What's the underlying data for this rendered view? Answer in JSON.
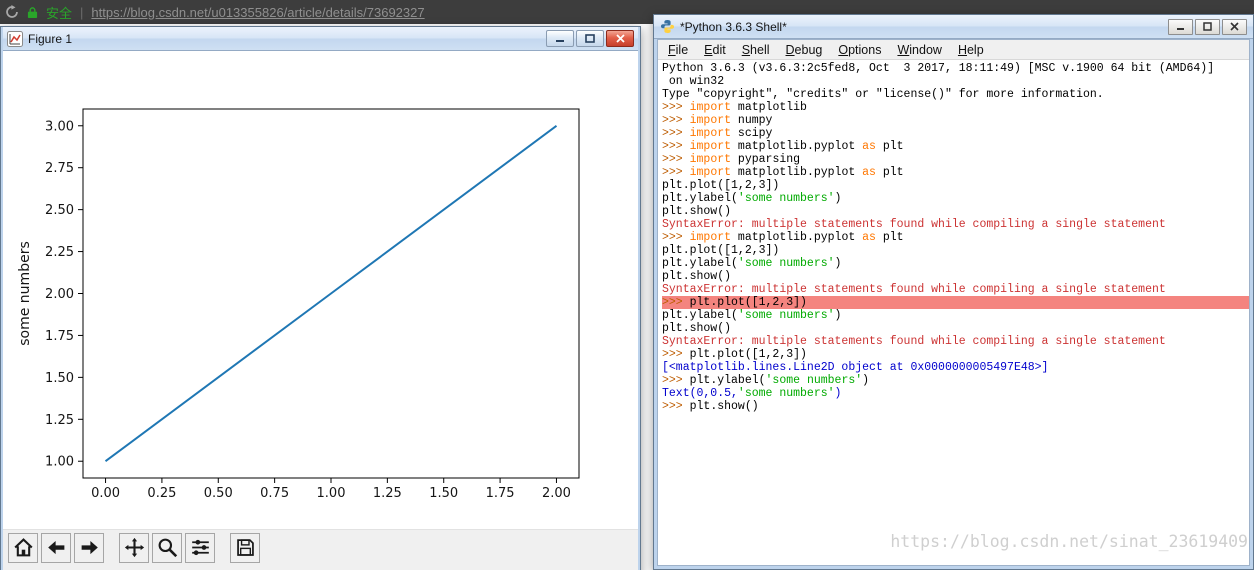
{
  "browser": {
    "security_text": "安全",
    "separator": "|",
    "url": "https://blog.csdn.net/u013355826/article/details/73692327"
  },
  "figure_window": {
    "title": "Figure 1",
    "toolbar": [
      "home",
      "back",
      "forward",
      "pan",
      "zoom",
      "configure",
      "save"
    ]
  },
  "chart_data": {
    "type": "line",
    "x": [
      0,
      1,
      2
    ],
    "y": [
      1,
      2,
      3
    ],
    "title": "",
    "xlabel": "",
    "ylabel": "some numbers",
    "xlim": [
      -0.1,
      2.1
    ],
    "ylim": [
      0.9,
      3.1
    ],
    "xticks": [
      0,
      0.25,
      0.5,
      0.75,
      1,
      1.25,
      1.5,
      1.75,
      2
    ],
    "yticks": [
      1,
      1.25,
      1.5,
      1.75,
      2,
      2.25,
      2.5,
      2.75,
      3
    ],
    "line_color": "#1f77b4",
    "grid": false,
    "legend": false
  },
  "shell_window": {
    "title": "*Python 3.6.3 Shell*",
    "menu": [
      "File",
      "Edit",
      "Shell",
      "Debug",
      "Options",
      "Window",
      "Help"
    ],
    "colors": {
      "plain": "#000000",
      "prompt": "#bd5c00",
      "keyword": "#ff7700",
      "string": "#00aa00",
      "error": "#cc3333",
      "output": "#0000cd",
      "highlight_bg": "#f4847f"
    },
    "lines": [
      {
        "segments": [
          {
            "c": "plain",
            "t": "Python 3.6.3 (v3.6.3:2c5fed8, Oct  3 2017, 18:11:49) [MSC v.1900 64 bit (AMD64)]"
          }
        ]
      },
      {
        "segments": [
          {
            "c": "plain",
            "t": " on win32"
          }
        ]
      },
      {
        "segments": [
          {
            "c": "plain",
            "t": "Type \"copyright\", \"credits\" or \"license()\" for more information."
          }
        ]
      },
      {
        "segments": [
          {
            "c": "prompt",
            "t": ">>> "
          },
          {
            "c": "keyword",
            "t": "import"
          },
          {
            "c": "plain",
            "t": " matplotlib"
          }
        ]
      },
      {
        "segments": [
          {
            "c": "prompt",
            "t": ">>> "
          },
          {
            "c": "keyword",
            "t": "import"
          },
          {
            "c": "plain",
            "t": " numpy"
          }
        ]
      },
      {
        "segments": [
          {
            "c": "prompt",
            "t": ">>> "
          },
          {
            "c": "keyword",
            "t": "import"
          },
          {
            "c": "plain",
            "t": " scipy"
          }
        ]
      },
      {
        "segments": [
          {
            "c": "prompt",
            "t": ">>> "
          },
          {
            "c": "keyword",
            "t": "import"
          },
          {
            "c": "plain",
            "t": " matplotlib.pyplot "
          },
          {
            "c": "keyword",
            "t": "as"
          },
          {
            "c": "plain",
            "t": " plt"
          }
        ]
      },
      {
        "segments": [
          {
            "c": "prompt",
            "t": ">>> "
          },
          {
            "c": "keyword",
            "t": "import"
          },
          {
            "c": "plain",
            "t": " pyparsing"
          }
        ]
      },
      {
        "segments": [
          {
            "c": "prompt",
            "t": ">>> "
          },
          {
            "c": "keyword",
            "t": "import"
          },
          {
            "c": "plain",
            "t": " matplotlib.pyplot "
          },
          {
            "c": "keyword",
            "t": "as"
          },
          {
            "c": "plain",
            "t": " plt"
          }
        ]
      },
      {
        "segments": [
          {
            "c": "plain",
            "t": "plt.plot([1,2,3])"
          }
        ]
      },
      {
        "segments": [
          {
            "c": "plain",
            "t": "plt.ylabel("
          },
          {
            "c": "string",
            "t": "'some numbers'"
          },
          {
            "c": "plain",
            "t": ")"
          }
        ]
      },
      {
        "segments": [
          {
            "c": "plain",
            "t": "plt.show()"
          }
        ]
      },
      {
        "segments": [
          {
            "c": "error",
            "t": "SyntaxError: multiple statements found while compiling a single statement"
          }
        ]
      },
      {
        "segments": [
          {
            "c": "prompt",
            "t": ">>> "
          },
          {
            "c": "keyword",
            "t": "import"
          },
          {
            "c": "plain",
            "t": " matplotlib.pyplot "
          },
          {
            "c": "keyword",
            "t": "as"
          },
          {
            "c": "plain",
            "t": " plt"
          }
        ]
      },
      {
        "segments": [
          {
            "c": "plain",
            "t": "plt.plot([1,2,3])"
          }
        ]
      },
      {
        "segments": [
          {
            "c": "plain",
            "t": "plt.ylabel("
          },
          {
            "c": "string",
            "t": "'some numbers'"
          },
          {
            "c": "plain",
            "t": ")"
          }
        ]
      },
      {
        "segments": [
          {
            "c": "plain",
            "t": "plt.show()"
          }
        ]
      },
      {
        "segments": [
          {
            "c": "error",
            "t": "SyntaxError: multiple statements found while compiling a single statement"
          }
        ]
      },
      {
        "highlight": true,
        "segments": [
          {
            "c": "prompt",
            "t": ">>> "
          },
          {
            "c": "plain",
            "t": "plt.plot([1,2,3])"
          }
        ]
      },
      {
        "segments": [
          {
            "c": "plain",
            "t": "plt.ylabel("
          },
          {
            "c": "string",
            "t": "'some numbers'"
          },
          {
            "c": "plain",
            "t": ")"
          }
        ]
      },
      {
        "segments": [
          {
            "c": "plain",
            "t": "plt.show()"
          }
        ]
      },
      {
        "segments": [
          {
            "c": "error",
            "t": "SyntaxError: multiple statements found while compiling a single statement"
          }
        ]
      },
      {
        "segments": [
          {
            "c": "prompt",
            "t": ">>> "
          },
          {
            "c": "plain",
            "t": "plt.plot([1,2,3])"
          }
        ]
      },
      {
        "segments": [
          {
            "c": "output",
            "t": "[<matplotlib.lines.Line2D object at 0x0000000005497E48>]"
          }
        ]
      },
      {
        "segments": [
          {
            "c": "prompt",
            "t": ">>> "
          },
          {
            "c": "plain",
            "t": "plt.ylabel("
          },
          {
            "c": "string",
            "t": "'some numbers'"
          },
          {
            "c": "plain",
            "t": ")"
          }
        ]
      },
      {
        "segments": [
          {
            "c": "output",
            "t": "Text(0,0.5,"
          },
          {
            "c": "string",
            "t": "'some numbers'"
          },
          {
            "c": "output",
            "t": ")"
          }
        ]
      },
      {
        "segments": [
          {
            "c": "prompt",
            "t": ">>> "
          },
          {
            "c": "plain",
            "t": "plt.show()"
          }
        ]
      }
    ]
  },
  "watermark": "https://blog.csdn.net/sinat_23619409"
}
